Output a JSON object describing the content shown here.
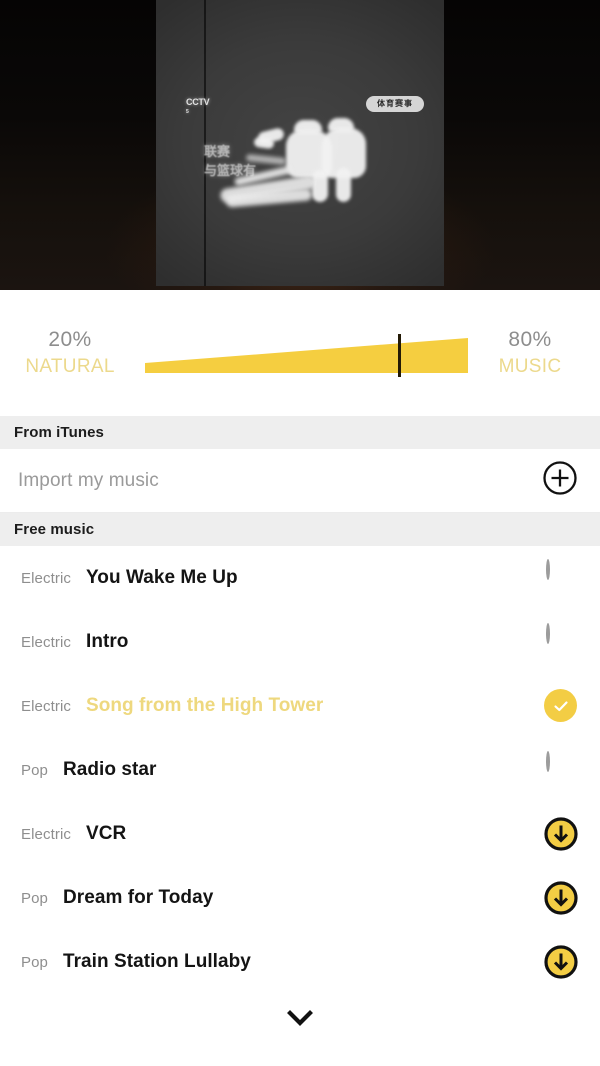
{
  "preview": {
    "channel_watermark": "CCTV",
    "channel_sub": "5",
    "caption_line1": "联赛",
    "caption_line2": "与篮球有",
    "score_pill": "体育赛事"
  },
  "mix": {
    "left": {
      "percent": "20%",
      "label": "NATURAL"
    },
    "right": {
      "percent": "80%",
      "label": "MUSIC"
    },
    "value": 80,
    "wedge_color": "#f5ce40",
    "accent_color": "#f3cd44",
    "label_color": "#ecd98c"
  },
  "sections": [
    {
      "title": "From iTunes"
    },
    {
      "title": "Free music"
    }
  ],
  "import": {
    "label": "Import my music",
    "icon": "plus-circle-icon"
  },
  "tracks": [
    {
      "genre": "Electric",
      "title": "You Wake Me Up",
      "state": "unselected"
    },
    {
      "genre": "Electric",
      "title": "Intro",
      "state": "unselected"
    },
    {
      "genre": "Electric",
      "title": "Song from the High Tower",
      "state": "selected"
    },
    {
      "genre": "Pop",
      "title": "Radio star",
      "state": "unselected"
    },
    {
      "genre": "Electric",
      "title": "VCR",
      "state": "download"
    },
    {
      "genre": "Pop",
      "title": "Dream for Today",
      "state": "download"
    },
    {
      "genre": "Pop",
      "title": "Train Station Lullaby",
      "state": "download"
    }
  ],
  "scroll_hint": {
    "icon": "chevron-down-icon"
  }
}
